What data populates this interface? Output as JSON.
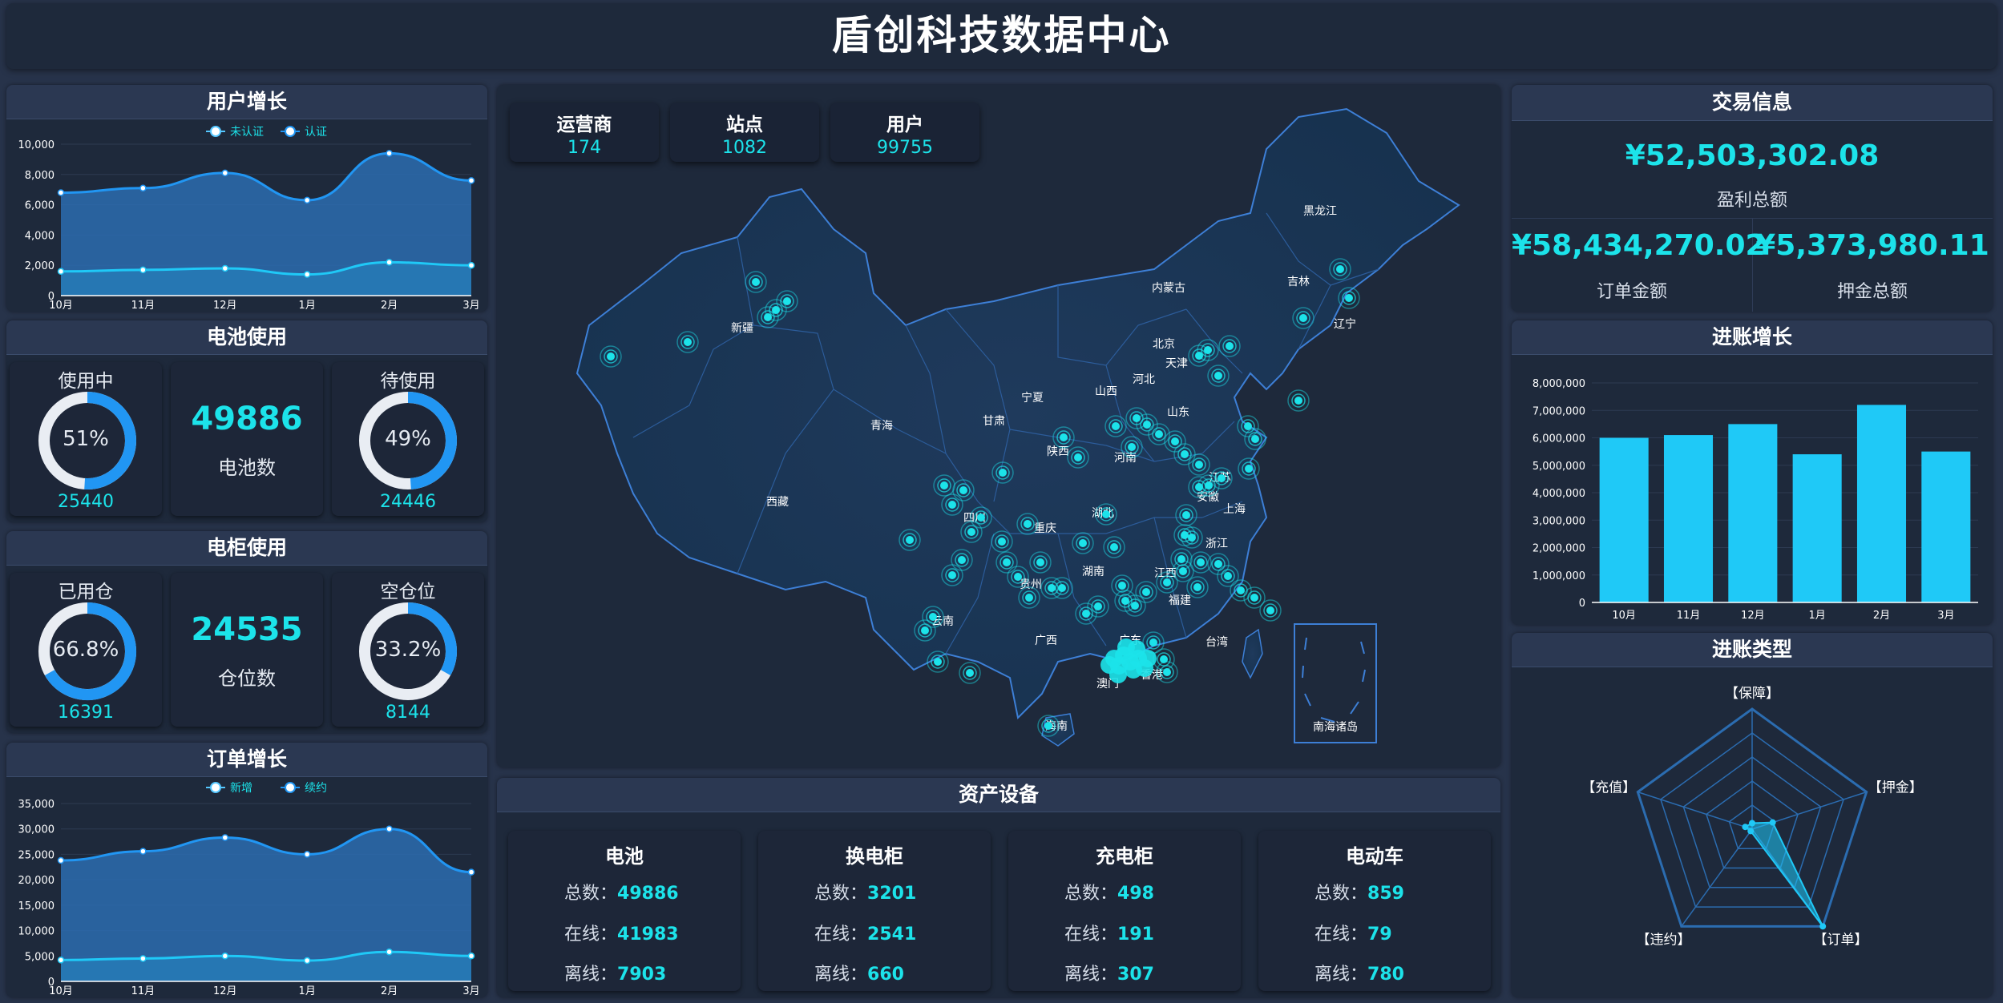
{
  "title": "盾创科技数据中心",
  "colors": {
    "cyan": "#1ce3ea",
    "blue": "#2196f3",
    "light_blue": "#1fc9f7",
    "panel": "#1e293b"
  },
  "user_growth": {
    "title": "用户增长",
    "legend": [
      "未认证",
      "认证"
    ],
    "chart_data": {
      "type": "area",
      "categories": [
        "10月",
        "11月",
        "12月",
        "1月",
        "2月",
        "3月"
      ],
      "series": [
        {
          "name": "未认证",
          "values": [
            6800,
            7100,
            8100,
            6300,
            9400,
            7600
          ]
        },
        {
          "name": "认证",
          "values": [
            1600,
            1700,
            1800,
            1400,
            2200,
            2000
          ]
        }
      ],
      "ylim": [
        0,
        10000
      ],
      "yticks": [
        "0",
        "2,000",
        "4,000",
        "6,000",
        "8,000",
        "10,000"
      ]
    }
  },
  "battery": {
    "title": "电池使用",
    "in_use": {
      "label": "使用中",
      "percent_text": "51%",
      "percent": 51,
      "count": "25440"
    },
    "center": {
      "value": "49886",
      "label": "电池数"
    },
    "idle": {
      "label": "待使用",
      "percent_text": "49%",
      "percent": 49,
      "count": "24446"
    }
  },
  "cabinet": {
    "title": "电柜使用",
    "used": {
      "label": "已用仓",
      "percent_text": "66.8%",
      "percent": 66.8,
      "count": "16391"
    },
    "center": {
      "value": "24535",
      "label": "仓位数"
    },
    "empty": {
      "label": "空仓位",
      "percent_text": "33.2%",
      "percent": 33.2,
      "count": "8144"
    }
  },
  "order_growth": {
    "title": "订单增长",
    "legend": [
      "新增",
      "续约"
    ],
    "chart_data": {
      "type": "area",
      "categories": [
        "10月",
        "11月",
        "12月",
        "1月",
        "2月",
        "3月"
      ],
      "series": [
        {
          "name": "新增",
          "values": [
            23800,
            25600,
            28300,
            25000,
            30000,
            21500
          ]
        },
        {
          "name": "续约",
          "values": [
            4200,
            4500,
            5000,
            4100,
            5800,
            5000
          ]
        }
      ],
      "ylim": [
        0,
        35000
      ],
      "yticks": [
        "0",
        "5,000",
        "10,000",
        "15,000",
        "20,000",
        "25,000",
        "30,000",
        "35,000"
      ]
    }
  },
  "stats": [
    {
      "label": "运营商",
      "value": "174"
    },
    {
      "label": "站点",
      "value": "1082"
    },
    {
      "label": "用户",
      "value": "99755"
    }
  ],
  "map": {
    "provinces": [
      "黑龙江",
      "吉林",
      "辽宁",
      "内蒙古",
      "北京",
      "天津",
      "河北",
      "山西",
      "山东",
      "宁夏",
      "甘肃",
      "青海",
      "新疆",
      "西藏",
      "陕西",
      "河南",
      "江苏",
      "安徽",
      "上海",
      "湖北",
      "四川",
      "重庆",
      "浙江",
      "湖南",
      "江西",
      "贵州",
      "福建",
      "云南",
      "广西",
      "广东",
      "台湾",
      "香港",
      "澳门",
      "海南"
    ],
    "inset_label": "南海诸岛"
  },
  "assets": {
    "title": "资产设备",
    "labels": {
      "total": "总数：",
      "online": "在线：",
      "offline": "离线："
    },
    "items": [
      {
        "name": "电池",
        "total": "49886",
        "online": "41983",
        "offline": "7903"
      },
      {
        "name": "换电柜",
        "total": "3201",
        "online": "2541",
        "offline": "660"
      },
      {
        "name": "充电柜",
        "total": "498",
        "online": "191",
        "offline": "307"
      },
      {
        "name": "电动车",
        "total": "859",
        "online": "79",
        "offline": "780"
      }
    ]
  },
  "transactions": {
    "title": "交易信息",
    "profit": {
      "value": "¥52,503,302.08",
      "label": "盈利总额"
    },
    "orders": {
      "value": "¥58,434,270.02",
      "label": "订单金额"
    },
    "deposit": {
      "value": "¥5,373,980.11",
      "label": "押金总额"
    }
  },
  "income_growth": {
    "title": "进账增长",
    "chart_data": {
      "type": "bar",
      "categories": [
        "10月",
        "11月",
        "12月",
        "1月",
        "2月",
        "3月"
      ],
      "values": [
        6000000,
        6100000,
        6500000,
        5400000,
        7200000,
        5500000
      ],
      "ylim": [
        0,
        8000000
      ],
      "yticks": [
        "0",
        "1,000,000",
        "2,000,000",
        "3,000,000",
        "4,000,000",
        "5,000,000",
        "6,000,000",
        "7,000,000",
        "8,000,000"
      ]
    }
  },
  "income_type": {
    "title": "进账类型",
    "chart_data": {
      "type": "radar",
      "indicators": [
        "【保障】",
        "【押金】",
        "【订单】",
        "【违约】",
        "【充值】"
      ],
      "values": [
        0.05,
        0.18,
        1.0,
        0.02,
        0.06
      ]
    }
  }
}
